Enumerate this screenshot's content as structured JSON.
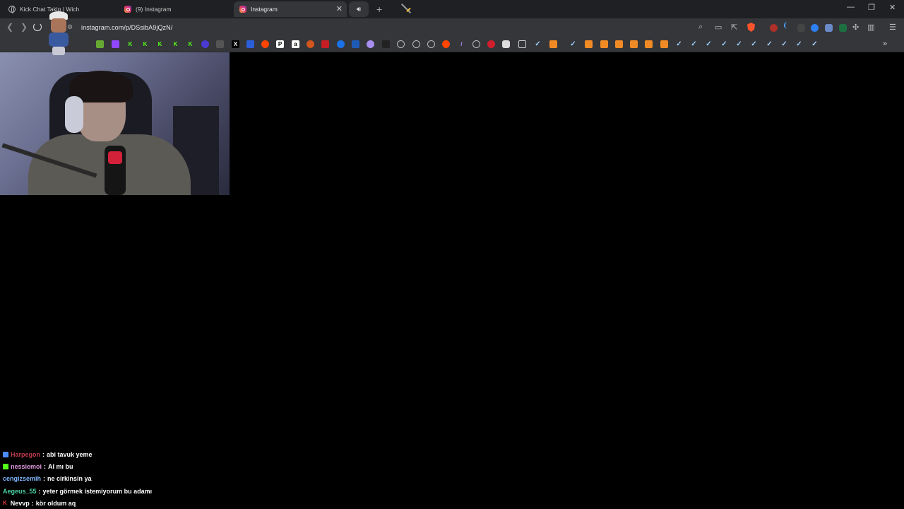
{
  "tabs": [
    {
      "title": "Kick Chat Takip | Wich",
      "favicon": "globe-icon",
      "active": false
    },
    {
      "title": "(9) Instagram",
      "favicon": "instagram-icon",
      "active": false
    },
    {
      "title": "Instagram",
      "favicon": "instagram-icon",
      "active": true
    }
  ],
  "address_bar": {
    "url": "instagram.com/p/DSsibA9jQzN/"
  },
  "colors": {
    "instagram": "#e1306c",
    "brave": "#fb542b",
    "chrome_bg": "#35363a",
    "tabstrip_bg": "#1f2023"
  },
  "chat": {
    "messages": [
      {
        "user": "Harpegon",
        "text": "abi tavuk yeme",
        "color": "#c33b4f",
        "badge_color": "#4a8cff"
      },
      {
        "user": "nessiemoi",
        "text": "AI mı bu",
        "color": "#e49ae0",
        "badge_color": "#53fc18"
      },
      {
        "user": "cengizsemih",
        "text": "ne cirkinsin ya",
        "color": "#7fb8ff",
        "badge_color": ""
      },
      {
        "user": "Aegeus_55",
        "text": "yeter görmek istemiyorum bu adamı",
        "color": "#4bd6a8",
        "badge_color": ""
      },
      {
        "user": "Nevvp",
        "text": "kör oldum aq",
        "color": "#ffffff",
        "badge_color": "#e53935"
      }
    ],
    "separator": ":"
  }
}
